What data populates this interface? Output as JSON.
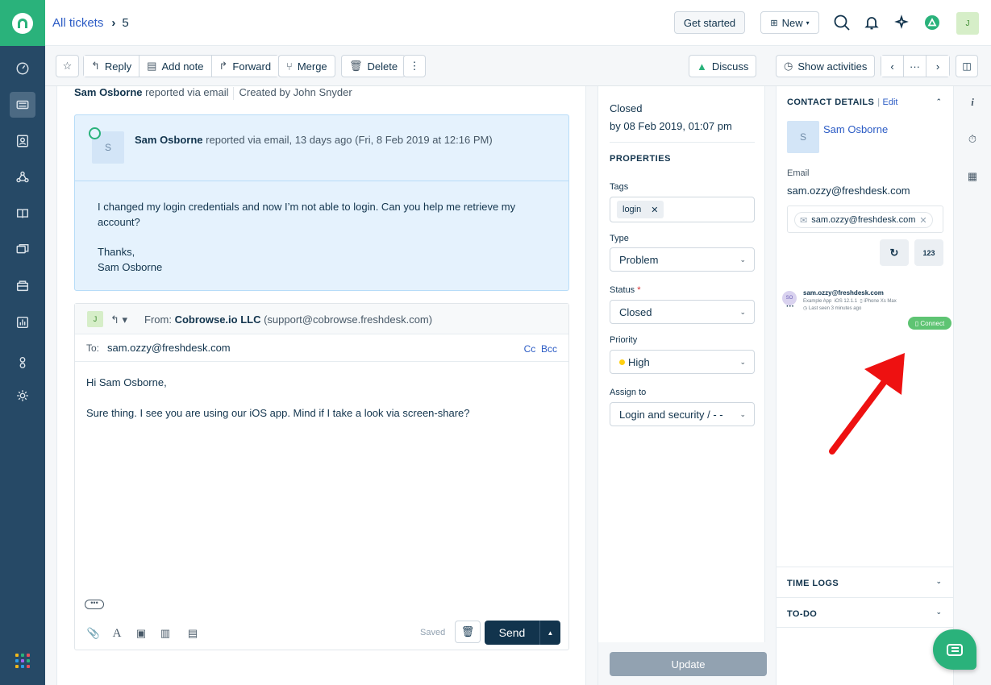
{
  "colors": {
    "brand": "#2ab27b",
    "rail": "#264966",
    "accent": "#2c5cc5",
    "send": "#12344d",
    "priority_high": "#ffd012",
    "annotation_arrow": "#ee1111"
  },
  "header": {
    "breadcrumb_link": "All tickets",
    "ticket_number": "5",
    "get_started": "Get started",
    "new_label": "New",
    "avatar_initial": "J"
  },
  "toolbar": {
    "reply": "Reply",
    "add_note": "Add note",
    "forward": "Forward",
    "merge": "Merge",
    "delete": "Delete",
    "more": "⋮",
    "discuss": "Discuss",
    "show_activities": "Show activities",
    "pager_more": "···"
  },
  "ticket": {
    "reporter": "Sam Osborne",
    "reported_via": "reported via email",
    "created_by": "Created by John Snyder",
    "message": {
      "avatar_initial": "S",
      "author": "Sam Osborne",
      "meta": "reported via email, 13 days ago (Fri, 8 Feb 2019 at 12:16 PM)",
      "body_line1": "I changed my login credentials and now I’m not able to login. Can you help me retrieve my account?",
      "body_line2": "Thanks,",
      "body_line3": "Sam Osborne"
    },
    "reply": {
      "avatar_initial": "J",
      "from_label": "From:",
      "from_name": "Cobrowse.io LLC",
      "from_email": "(support@cobrowse.freshdesk.com)",
      "to_label": "To:",
      "to_value": "sam.ozzy@freshdesk.com",
      "cc": "Cc",
      "bcc": "Bcc",
      "greeting": "Hi Sam Osborne,",
      "text": "Sure thing. I see you are using our iOS app. Mind if I take a look via screen-share?",
      "saved": "Saved",
      "send": "Send"
    }
  },
  "properties": {
    "status_title": "Closed",
    "status_date": "by 08 Feb 2019, 01:07 pm",
    "section": "PROPERTIES",
    "tags_label": "Tags",
    "tag_value": "login",
    "type_label": "Type",
    "type_value": "Problem",
    "status_label": "Status",
    "status_value": "Closed",
    "priority_label": "Priority",
    "priority_value": "High",
    "assign_label": "Assign to",
    "assign_value": "Login and security / - -",
    "update": "Update"
  },
  "contact": {
    "title": "CONTACT DETAILS",
    "edit": "Edit",
    "avatar_initial": "S",
    "name": "Sam Osborne",
    "email_label": "Email",
    "email": "sam.ozzy@freshdesk.com",
    "chip_email": "sam.ozzy@freshdesk.com",
    "code_button": "123",
    "device": {
      "initials": "SO",
      "email": "sam.ozzy@freshdesk.com",
      "app": "Example App",
      "os": "iOS 12.1.1",
      "model": "iPhone Xs Max",
      "last_seen": "Last seen 3 minutes ago",
      "connect": "Connect"
    },
    "time_logs": "TIME LOGS",
    "todo": "TO-DO"
  }
}
